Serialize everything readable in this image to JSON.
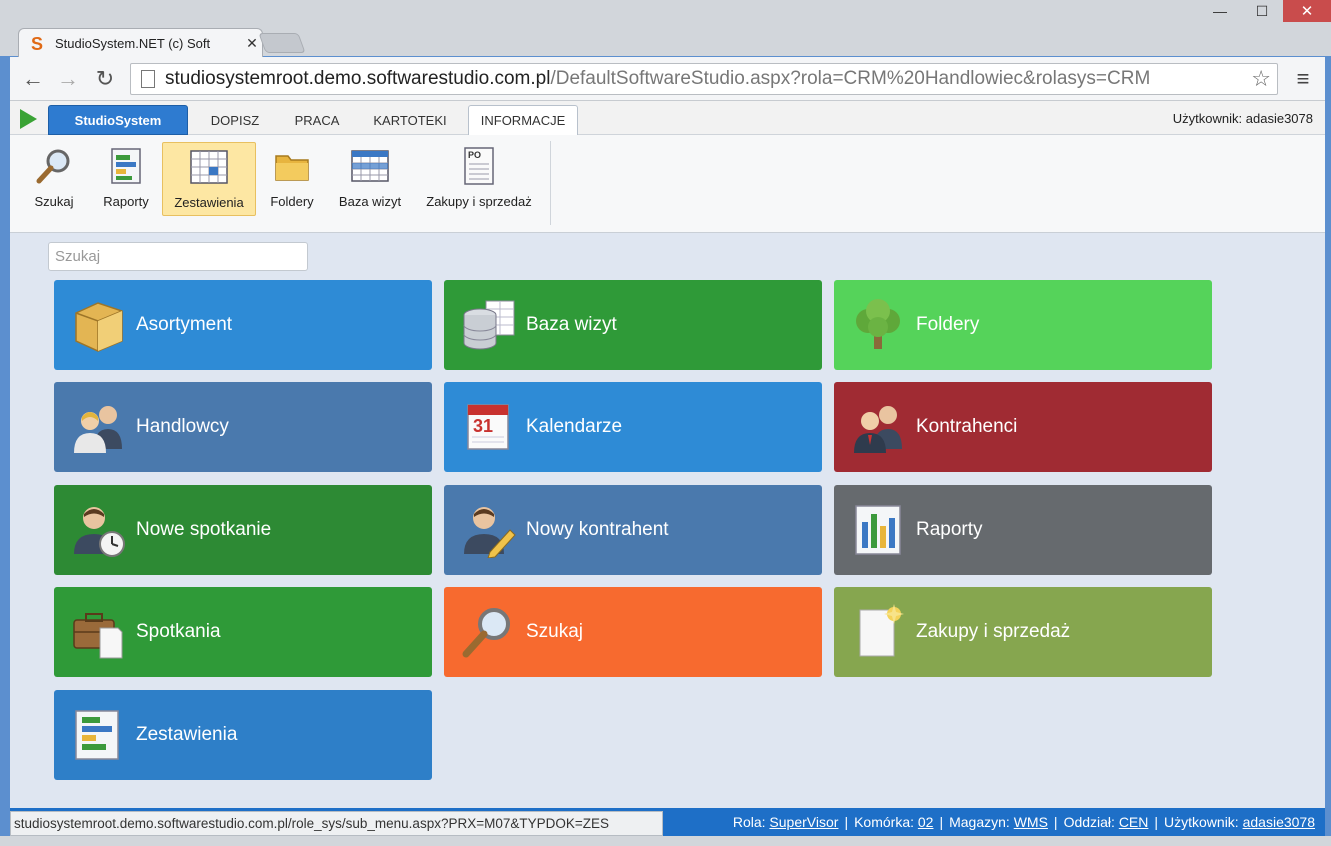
{
  "browser": {
    "tab_title": "StudioSystem.NET (c) Soft",
    "url_host": "studiosystemroot.demo.softwarestudio.com.pl",
    "url_path": "/DefaultSoftwareStudio.aspx?rola=CRM%20Handlowiec&rolasys=CRM",
    "status_url": "studiosystemroot.demo.softwarestudio.com.pl/role_sys/sub_menu.aspx?PRX=M07&TYPDOK=ZES"
  },
  "app": {
    "brand_tab": "StudioSystem",
    "tabs": [
      "DOPISZ",
      "PRACA",
      "KARTOTEKI",
      "INFORMACJE"
    ],
    "active_tab": "INFORMACJE",
    "user_label": "Użytkownik: adasie3078"
  },
  "ribbon": {
    "items": [
      "Szukaj",
      "Raporty",
      "Zestawienia",
      "Foldery",
      "Baza wizyt",
      "Zakupy i sprzedaż"
    ],
    "selected": "Zestawienia"
  },
  "search": {
    "placeholder": "Szukaj"
  },
  "tiles": [
    {
      "label": "Asortyment",
      "color": "#2e8bd6",
      "icon": "box-icon"
    },
    {
      "label": "Baza wizyt",
      "color": "#2f9a38",
      "icon": "database-icon"
    },
    {
      "label": "Foldery",
      "color": "#55d35a",
      "icon": "tree-icon"
    },
    {
      "label": "Handlowcy",
      "color": "#4a79ad",
      "icon": "users-icon"
    },
    {
      "label": "Kalendarze",
      "color": "#2e8bd6",
      "icon": "calendar-icon"
    },
    {
      "label": "Kontrahenci",
      "color": "#a02b33",
      "icon": "users-icon"
    },
    {
      "label": "Nowe spotkanie",
      "color": "#2d8a34",
      "icon": "user-clock-icon"
    },
    {
      "label": "Nowy kontrahent",
      "color": "#4a79ad",
      "icon": "user-edit-icon"
    },
    {
      "label": "Raporty",
      "color": "#666a6e",
      "icon": "report-icon"
    },
    {
      "label": "Spotkania",
      "color": "#2f9a38",
      "icon": "briefcase-icon"
    },
    {
      "label": "Szukaj",
      "color": "#f76a2f",
      "icon": "magnifier-icon"
    },
    {
      "label": "Zakupy i sprzedaż",
      "color": "#86a64f",
      "icon": "document-icon"
    },
    {
      "label": "Zestawienia",
      "color": "#2e7fc8",
      "icon": "report-icon"
    }
  ],
  "status": {
    "rola_label": "Rola:",
    "rola_value": "SuperVisor",
    "komorka_label": "Komórka:",
    "komorka_value": "02",
    "magazyn_label": "Magazyn:",
    "magazyn_value": "WMS",
    "oddzial_label": "Oddział:",
    "oddzial_value": "CEN",
    "uzytkownik_label": "Użytkownik:",
    "uzytkownik_value": "adasie3078"
  }
}
